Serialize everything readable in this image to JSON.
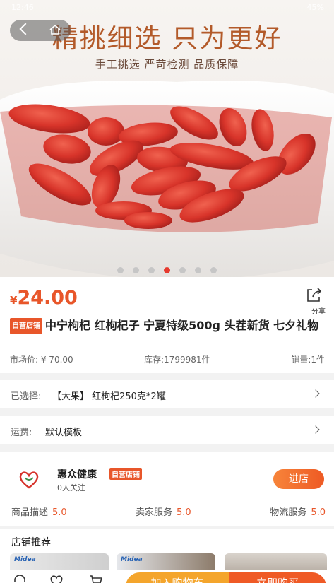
{
  "status_bar": {
    "time": "12:46",
    "battery": "45%"
  },
  "banner": {
    "headline": "精挑细选  只为更好",
    "subline": "手工挑选  严苛检测  品质保障"
  },
  "carousel": {
    "count": 7,
    "active_index": 3
  },
  "product": {
    "currency": "¥",
    "price": "24.00",
    "share_label": "分享",
    "badge": "自营店铺",
    "title": "中宁枸杞 红枸杞子 宁夏特级500g 头茬新货 七夕礼物",
    "market_price": "市场价: ¥ 70.00",
    "stock": "库存:1799981件",
    "sales": "销量:1件"
  },
  "selection": {
    "label": "已选择:",
    "value": "【大果】 红枸杞250克*2罐"
  },
  "shipping": {
    "label": "运费:",
    "value": "默认模板"
  },
  "store": {
    "name": "惠众健康",
    "badge": "自营店铺",
    "followers": "0人关注",
    "enter_label": "进店",
    "scores": [
      {
        "label": "商品描述",
        "value": "5.0"
      },
      {
        "label": "卖家服务",
        "value": "5.0"
      },
      {
        "label": "物流服务",
        "value": "5.0"
      }
    ]
  },
  "recommend": {
    "title": "店铺推荐",
    "brand_text": "Midea"
  },
  "bottom_bar": {
    "icons": [
      "customer-service-icon",
      "favorite-icon",
      "cart-icon"
    ],
    "add_to_cart": "加入购物车",
    "buy_now": "立即购买"
  },
  "colors": {
    "accent": "#e8562a",
    "cart_button": "#f4a52c",
    "buy_button": "#ef5a26"
  }
}
